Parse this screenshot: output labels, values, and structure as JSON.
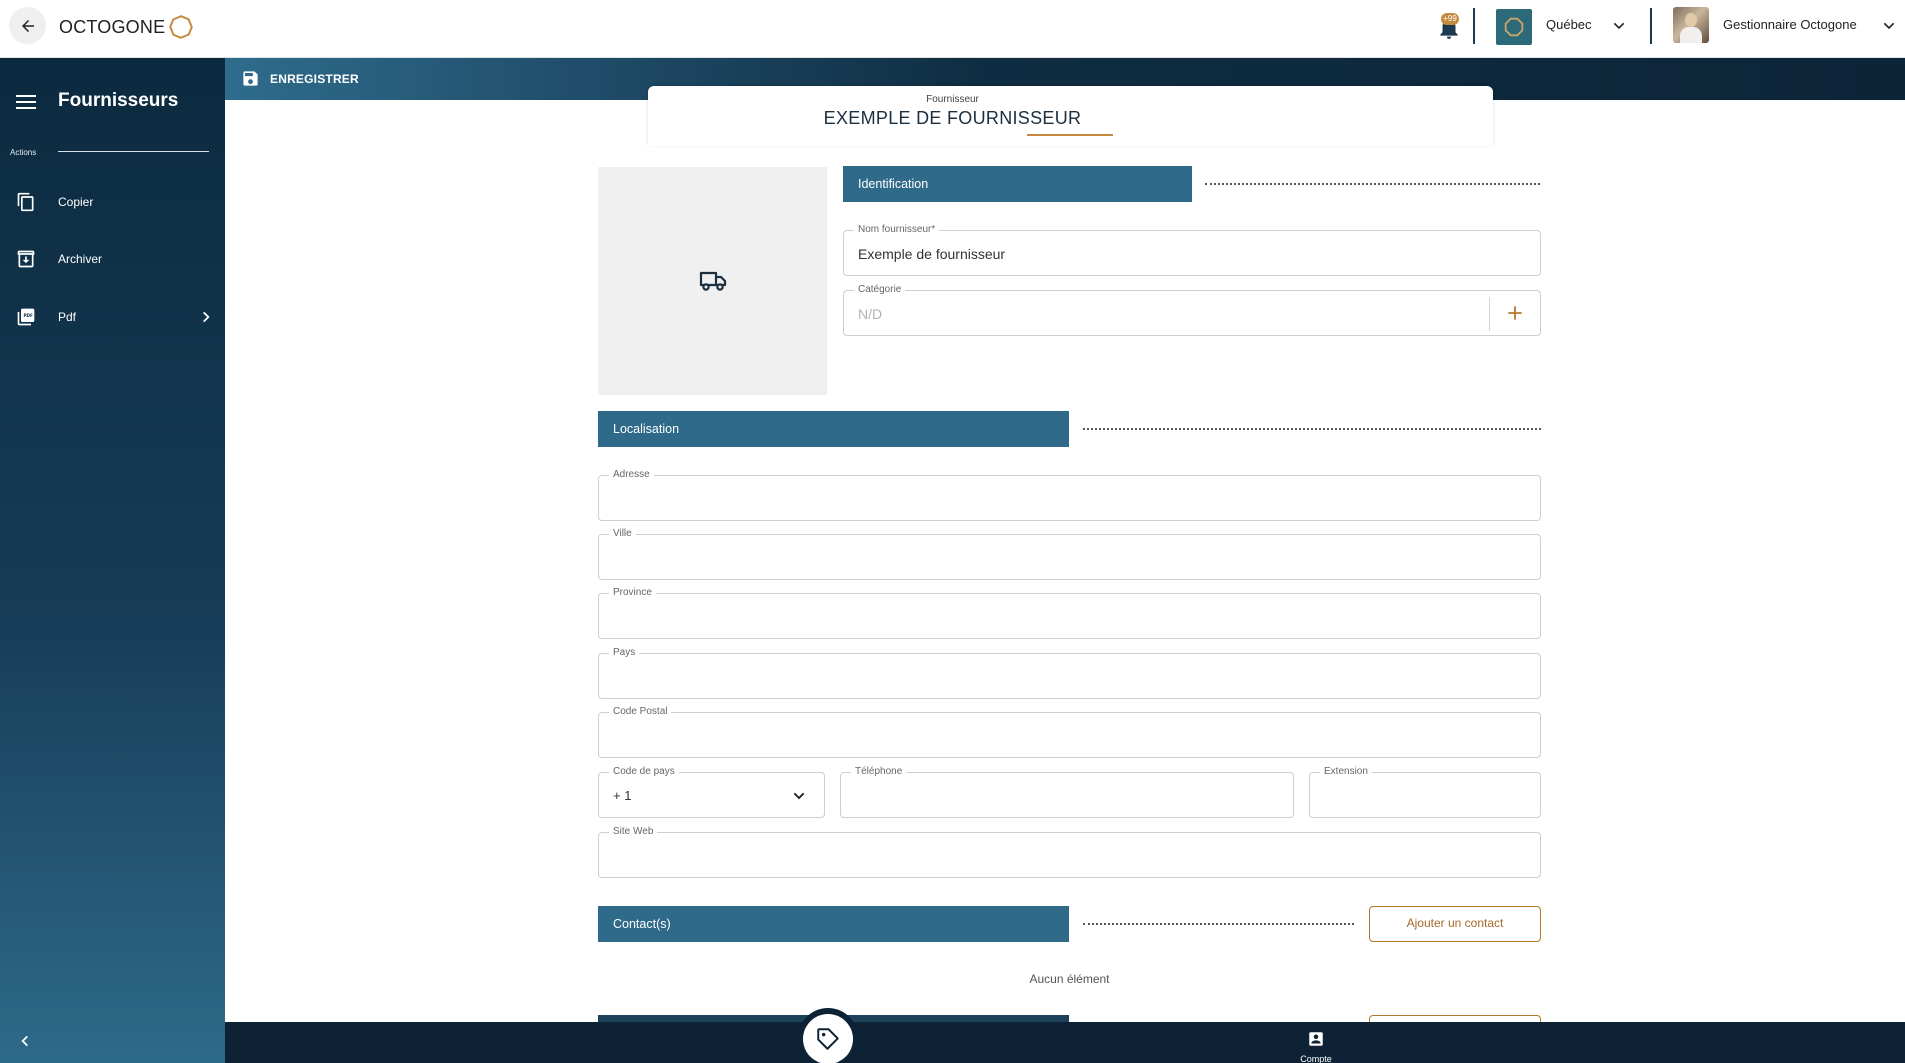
{
  "topbar": {
    "brand": "OCTOGONE",
    "notification_badge": "+99",
    "organization": "Québec",
    "user_name": "Gestionnaire Octogone"
  },
  "sidebar": {
    "title": "Fournisseurs",
    "actions_label": "Actions",
    "items": [
      {
        "label": "Copier",
        "icon": "copy-icon"
      },
      {
        "label": "Archiver",
        "icon": "archive-icon"
      },
      {
        "label": "Pdf",
        "icon": "pdf-icon"
      }
    ]
  },
  "toolbar": {
    "save_label": "ENREGISTRER"
  },
  "header": {
    "kicker": "Fournisseur",
    "title": "EXEMPLE DE FOURNISSEUR"
  },
  "identification": {
    "section_label": "Identification",
    "supplier_name_label": "Nom fournisseur*",
    "supplier_name_value": "Exemple de fournisseur",
    "category_label": "Catégorie",
    "category_placeholder": "N/D"
  },
  "location": {
    "section_label": "Localisation",
    "address_label": "Adresse",
    "address_value": "",
    "city_label": "Ville",
    "city_value": "",
    "province_label": "Province",
    "province_value": "",
    "country_label": "Pays",
    "country_value": "",
    "postal_label": "Code Postal",
    "postal_value": "",
    "country_code_label": "Code de pays",
    "country_code_value": "+ 1",
    "phone_label": "Téléphone",
    "phone_value": "",
    "extension_label": "Extension",
    "extension_value": "",
    "website_label": "Site Web",
    "website_value": ""
  },
  "contacts": {
    "section_label": "Contact(s)",
    "add_label": "Ajouter un contact",
    "empty_text": "Aucun élément"
  },
  "bottombar": {
    "account_label": "Compte"
  },
  "colors": {
    "sidebar_dark": "#0c2a3f",
    "section_blue": "#2f6a8a",
    "accent_gold": "#c68a3f",
    "bottom_bar": "#0d2235"
  }
}
